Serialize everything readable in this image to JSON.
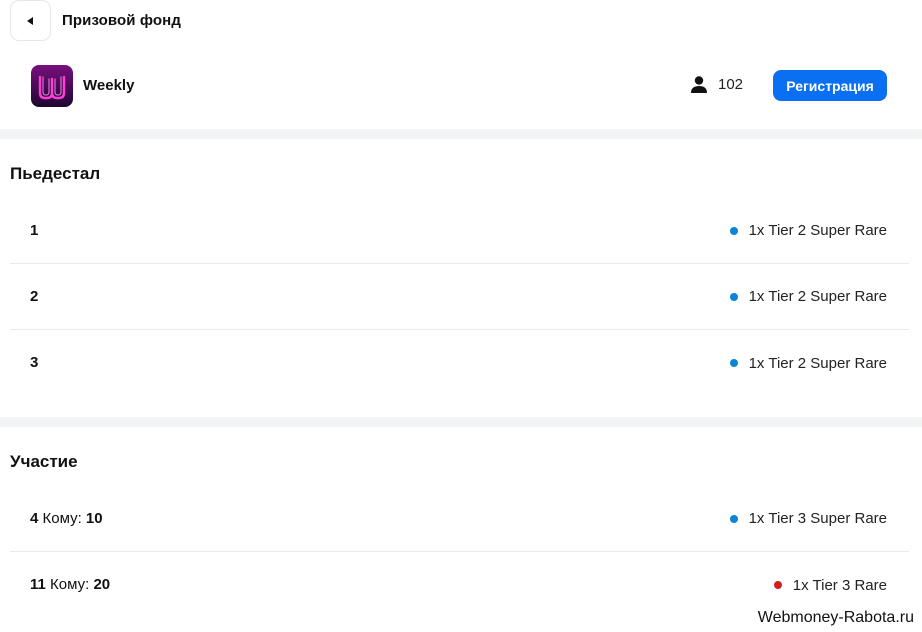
{
  "header": {
    "title": "Призовой фонд"
  },
  "tournament": {
    "name": "Weekly",
    "players_count": "102",
    "register_label": "Регистрация",
    "logo_letter": "W"
  },
  "podium": {
    "title": "Пьедестал",
    "rows": [
      {
        "place": "1",
        "reward": "1x Tier 2 Super Rare",
        "dot_color": "#0a84d6"
      },
      {
        "place": "2",
        "reward": "1x Tier 2 Super Rare",
        "dot_color": "#0a84d6"
      },
      {
        "place": "3",
        "reward": "1x Tier 2 Super Rare",
        "dot_color": "#0a84d6"
      }
    ]
  },
  "participation": {
    "title": "Участие",
    "rows": [
      {
        "place": "4",
        "to_label": " Кому: ",
        "to_value": "10",
        "reward": "1x Tier 3 Super Rare",
        "dot_color": "#0a84d6"
      },
      {
        "place": "11",
        "to_label": " Кому: ",
        "to_value": "20",
        "reward": "1x Tier 3 Rare",
        "dot_color": "#d0201a"
      }
    ]
  },
  "watermark": "Webmoney-Rabota.ru",
  "colors": {
    "accent": "#0a6ff0",
    "super_rare": "#0a84d6",
    "rare": "#d0201a"
  }
}
